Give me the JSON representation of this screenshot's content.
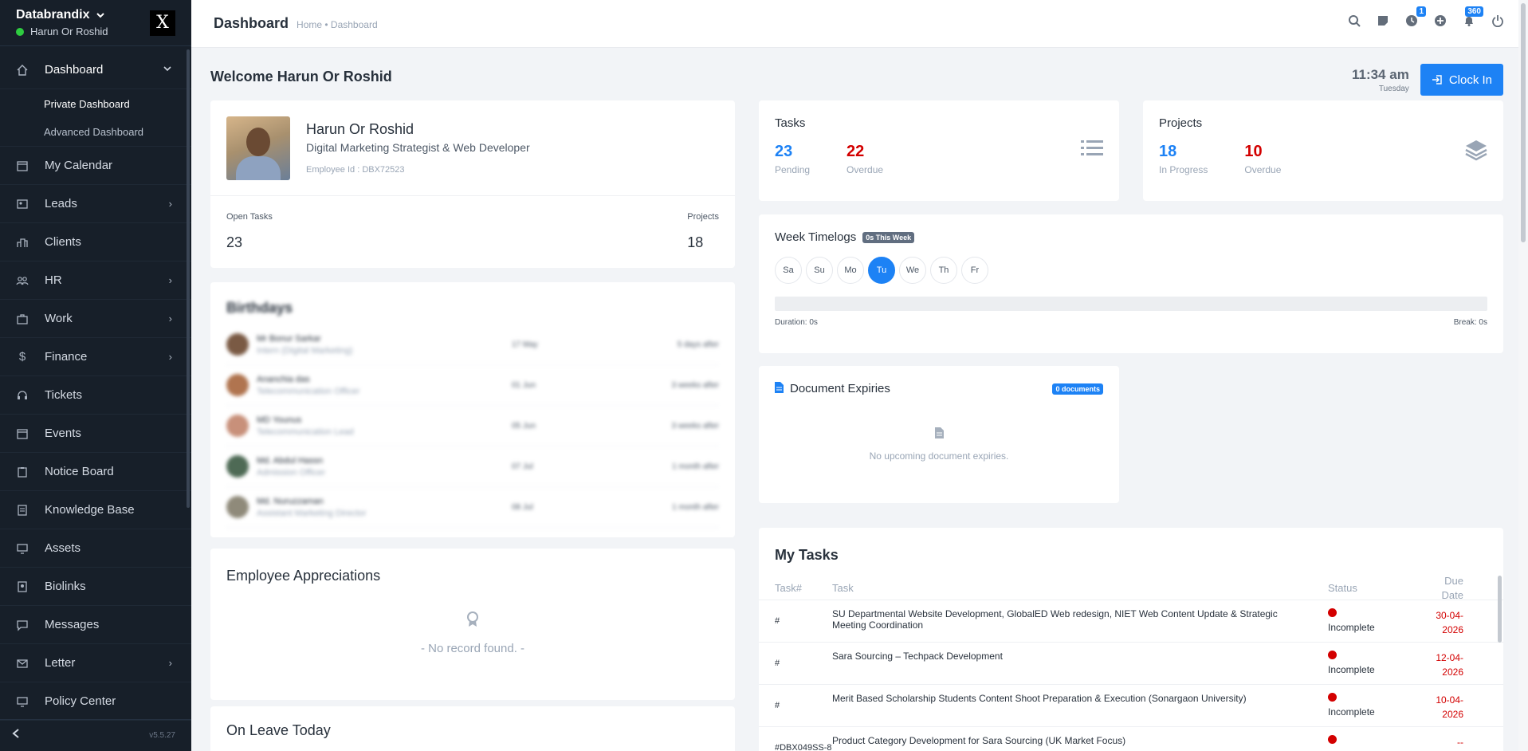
{
  "sidebar": {
    "company": "Databrandix",
    "user": "Harun Or Roshid",
    "logo_glyph": "X",
    "items": [
      {
        "label": "Dashboard",
        "icon": "home-icon",
        "chev": "⌄"
      },
      {
        "label": "My Calendar",
        "icon": "calendar-icon",
        "chev": ""
      },
      {
        "label": "Leads",
        "icon": "leads-icon",
        "chev": "›"
      },
      {
        "label": "Clients",
        "icon": "clients-icon",
        "chev": ""
      },
      {
        "label": "HR",
        "icon": "people-icon",
        "chev": "›"
      },
      {
        "label": "Work",
        "icon": "briefcase-icon",
        "chev": "›"
      },
      {
        "label": "Finance",
        "icon": "dollar-icon",
        "chev": "›"
      },
      {
        "label": "Tickets",
        "icon": "headset-icon",
        "chev": ""
      },
      {
        "label": "Events",
        "icon": "events-icon",
        "chev": ""
      },
      {
        "label": "Notice Board",
        "icon": "clipboard-icon",
        "chev": ""
      },
      {
        "label": "Knowledge Base",
        "icon": "book-icon",
        "chev": ""
      },
      {
        "label": "Assets",
        "icon": "monitor-icon",
        "chev": ""
      },
      {
        "label": "Biolinks",
        "icon": "biolinks-icon",
        "chev": ""
      },
      {
        "label": "Messages",
        "icon": "chat-icon",
        "chev": ""
      },
      {
        "label": "Letter",
        "icon": "envelope-icon",
        "chev": "›"
      },
      {
        "label": "Policy Center",
        "icon": "policy-icon",
        "chev": ""
      }
    ],
    "submenu": [
      "Private Dashboard",
      "Advanced Dashboard"
    ],
    "version": "v5.5.27"
  },
  "topbar": {
    "title": "Dashboard",
    "breadcrumb": "Home • Dashboard",
    "badge_timer": "1",
    "badge_notifications": "360"
  },
  "welcome": "Welcome Harun Or Roshid",
  "clock": {
    "time": "11:34 am",
    "day": "Tuesday",
    "button": "Clock In"
  },
  "profile": {
    "name": "Harun Or Roshid",
    "role": "Digital Marketing Strategist & Web Developer",
    "employee_id": "Employee Id : DBX72523",
    "open_tasks_label": "Open Tasks",
    "open_tasks": "23",
    "projects_label": "Projects",
    "projects": "18"
  },
  "birthdays": {
    "title": "Birthdays",
    "rows": [
      {
        "name": "Mr Bonur Sarkar",
        "role": "Intern (Digital Marketing)",
        "date": "17 May",
        "when": "5 days after"
      },
      {
        "name": "Ananchia das",
        "role": "Telecommunication Officer",
        "date": "01 Jun",
        "when": "3 weeks after"
      },
      {
        "name": "MD Younus",
        "role": "Telecommunication Lead",
        "date": "05 Jun",
        "when": "3 weeks after"
      },
      {
        "name": "Md. Abdul Hassn",
        "role": "Admission Officer",
        "date": "07 Jul",
        "when": "1 month after"
      },
      {
        "name": "Md. Nuruzzaman",
        "role": "Assistant Marketing Director",
        "date": "08 Jul",
        "when": "1 month after"
      }
    ]
  },
  "appreciations": {
    "title": "Employee Appreciations",
    "empty": "- No record found. -"
  },
  "on_leave": {
    "title": "On Leave Today"
  },
  "tasks_card": {
    "title": "Tasks",
    "pending": "23",
    "pending_label": "Pending",
    "overdue": "22",
    "overdue_label": "Overdue"
  },
  "projects_card": {
    "title": "Projects",
    "in_progress": "18",
    "in_progress_label": "In Progress",
    "overdue": "10",
    "overdue_label": "Overdue"
  },
  "timelogs": {
    "title": "Week Timelogs",
    "badge": "0s This Week",
    "days": [
      "Sa",
      "Su",
      "Mo",
      "Tu",
      "We",
      "Th",
      "Fr"
    ],
    "active_day": "Tu",
    "duration": "Duration: 0s",
    "break": "Break: 0s"
  },
  "documents": {
    "title": "Document Expiries",
    "badge": "0 documents",
    "empty": "No upcoming document expiries."
  },
  "my_tasks": {
    "title": "My Tasks",
    "headers": {
      "num": "Task#",
      "task": "Task",
      "status": "Status",
      "due": "Due Date"
    },
    "rows": [
      {
        "num": "#",
        "task": "SU Departmental Website Development, GlobalED Web redesign, NIET Web Content Update & Strategic Meeting Coordination",
        "status": "Incomplete",
        "due": "30-04-2026"
      },
      {
        "num": "#",
        "task": "Sara Sourcing – Techpack Development",
        "status": "Incomplete",
        "due": "12-04-2026"
      },
      {
        "num": "#",
        "task": "Merit Based Scholarship Students Content Shoot Preparation & Execution (Sonargaon University)",
        "status": "Incomplete",
        "due": "10-04-2026"
      },
      {
        "num": "#DBX049SS-8",
        "task": "Product Category Development for Sara Sourcing (UK Market Focus)",
        "status": "",
        "due": "--"
      }
    ]
  },
  "colors": {
    "accent": "#1d82f5",
    "danger": "#d30000",
    "sidebar": "#171f29"
  }
}
